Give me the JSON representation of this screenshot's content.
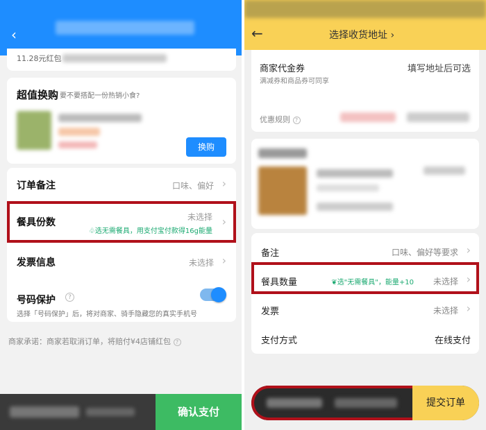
{
  "left": {
    "redpack_text": "11.28元红包",
    "swap": {
      "title": "超值换购",
      "subtitle": "要不要搭配一份热销小食?",
      "button": "换购"
    },
    "rows": {
      "note_label": "订单备注",
      "note_value": "口味、偏好",
      "utensil_label": "餐具份数",
      "utensil_value": "未选择",
      "utensil_tip": "选无需餐具，用支付宝付款得16g能量",
      "invoice_label": "发票信息",
      "invoice_value": "未选择",
      "privacy_label": "号码保护",
      "privacy_desc": "选择「号码保护」后，将对商家、骑手隐藏您的真实手机号",
      "privacy_on": true
    },
    "promise": "商家承诺：商家若取消订单，将赔付¥4店铺红包",
    "confirm_button": "确认支付"
  },
  "right": {
    "header_title": "选择收货地址",
    "voucher_label": "商家代金券",
    "voucher_value": "填写地址后可选",
    "voucher_sub": "满减券和商品券可同享",
    "discount_rule": "优惠规则",
    "rows": {
      "note_label": "备注",
      "note_value": "口味、偏好等要求",
      "utensil_label": "餐具数量",
      "utensil_tip": "选\"无需餐具\"，能量+10",
      "utensil_value": "未选择",
      "invoice_label": "发票",
      "invoice_value": "未选择",
      "pay_label": "支付方式",
      "pay_value": "在线支付"
    },
    "submit_button": "提交订单"
  },
  "colors": {
    "left_accent": "#1e8dff",
    "left_confirm": "#3dbb63",
    "right_accent": "#f9d156",
    "highlight": "#b0101a",
    "tip_green": "#1aa970"
  },
  "icons": {
    "back": "back-arrow-icon",
    "chevron": "chevron-right-icon",
    "help": "question-circle-icon",
    "leaf": "leaf-icon"
  }
}
